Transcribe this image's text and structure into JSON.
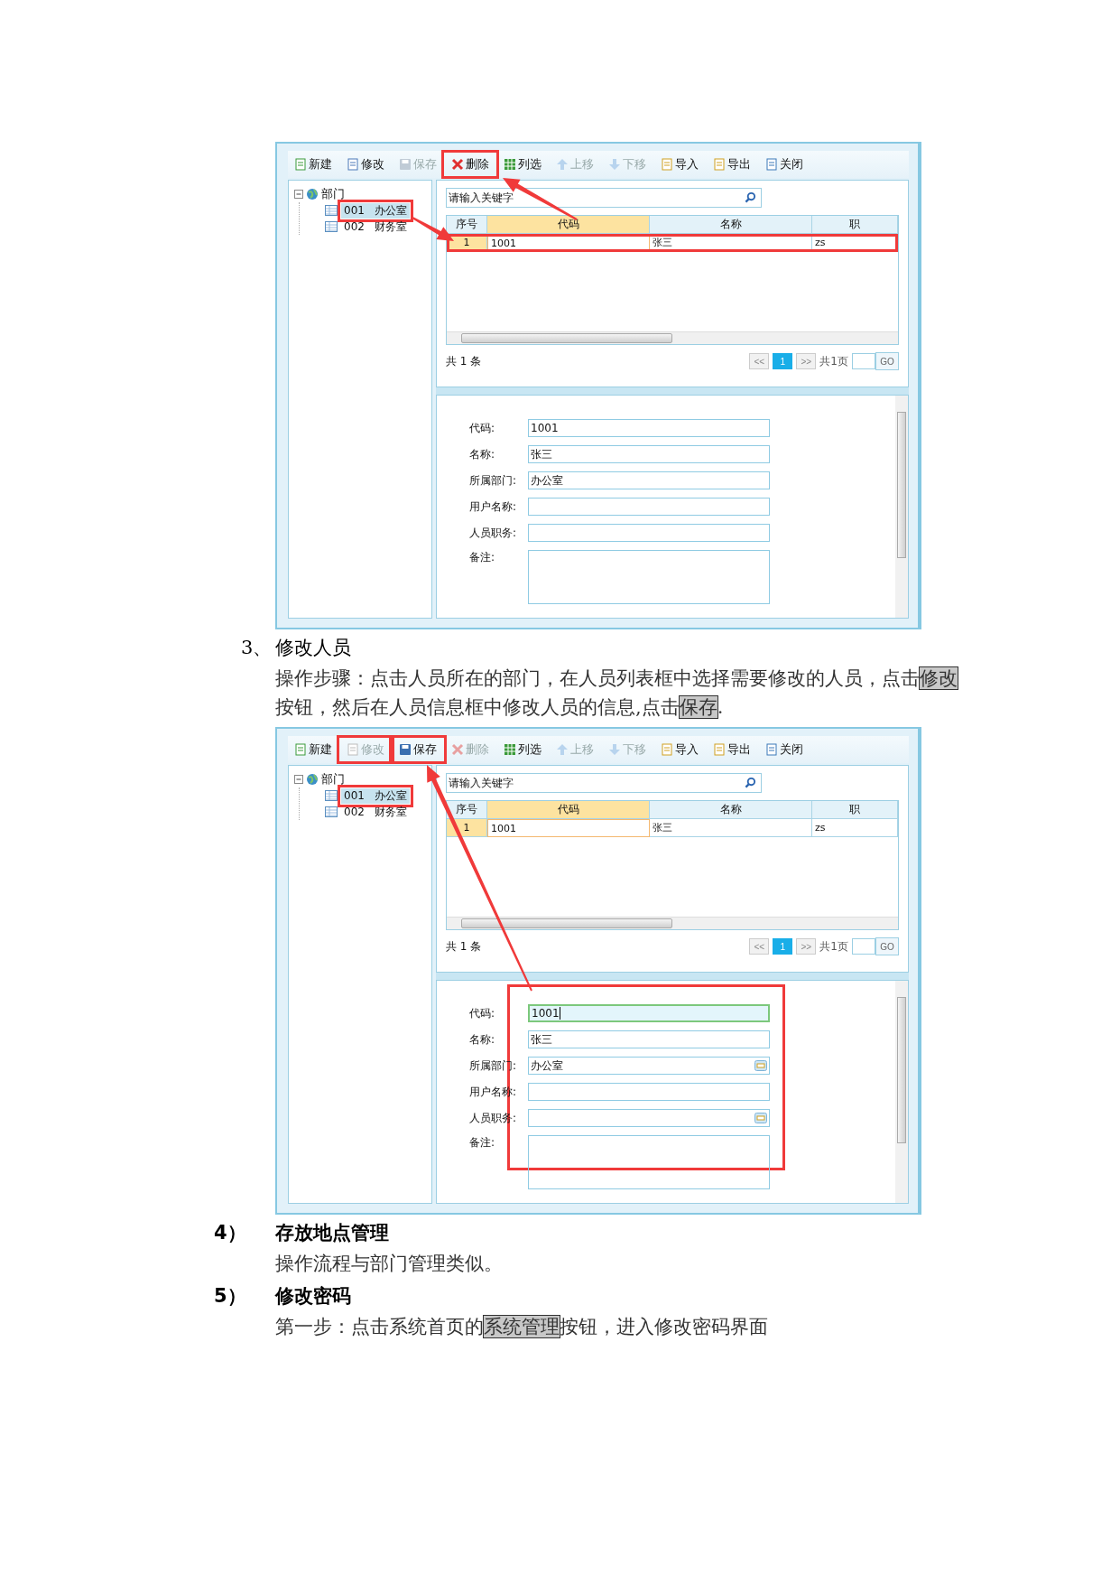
{
  "screenshots": [
    {
      "toolbar": [
        {
          "kind": "new",
          "label": "新建",
          "disabled": false,
          "highlighted": false
        },
        {
          "kind": "edit",
          "label": "修改",
          "disabled": false,
          "highlighted": false
        },
        {
          "kind": "save",
          "label": "保存",
          "disabled": true,
          "highlighted": false
        },
        {
          "kind": "delete",
          "label": "删除",
          "disabled": false,
          "highlighted": true
        },
        {
          "kind": "columns",
          "label": "列选",
          "disabled": false,
          "highlighted": false
        },
        {
          "kind": "up",
          "label": "上移",
          "disabled": true,
          "highlighted": false
        },
        {
          "kind": "down",
          "label": "下移",
          "disabled": true,
          "highlighted": false
        },
        {
          "kind": "import",
          "label": "导入",
          "disabled": false,
          "highlighted": false
        },
        {
          "kind": "export",
          "label": "导出",
          "disabled": false,
          "highlighted": false
        },
        {
          "kind": "close",
          "label": "关闭",
          "disabled": false,
          "highlighted": false
        }
      ],
      "tree": {
        "label": "部门",
        "expanded": true,
        "children": [
          {
            "code": "001",
            "name": "办公室",
            "selected": true,
            "highlighted": true
          },
          {
            "code": "002",
            "name": "财务室",
            "selected": false,
            "highlighted": false
          }
        ]
      },
      "search": {
        "placeholder": "请输入关键字"
      },
      "columns": [
        {
          "label": "序号",
          "sorted": false
        },
        {
          "label": "代码",
          "sorted": true
        },
        {
          "label": "名称",
          "sorted": false
        },
        {
          "label": "职",
          "sorted": false
        }
      ],
      "rows": [
        {
          "cells": [
            "1",
            "1001",
            "张三",
            "zs"
          ],
          "highlighted": true
        }
      ],
      "total": "共 1 条",
      "pager": {
        "prev": "<<",
        "page": "1",
        "next": ">>",
        "pages": "共1页",
        "go": "GO"
      },
      "form": {
        "highlighted": false,
        "fields": [
          {
            "kind": "text",
            "label": "代码:",
            "value": "1001",
            "focused": false
          },
          {
            "kind": "text",
            "label": "名称:",
            "value": "张三",
            "focused": false
          },
          {
            "kind": "text",
            "label": "所属部门:",
            "value": "办公室",
            "focused": false
          },
          {
            "kind": "text",
            "label": "用户名称:",
            "focused": false
          },
          {
            "kind": "text",
            "label": "人员职务:",
            "focused": false
          },
          {
            "kind": "textarea",
            "label": "备注:",
            "focused": false
          }
        ]
      },
      "arrows": [
        {
          "kind": "tree-to-grid"
        },
        {
          "kind": "grid-to-toolbar"
        }
      ]
    },
    {
      "toolbar": [
        {
          "kind": "new",
          "label": "新建",
          "disabled": false,
          "highlighted": false
        },
        {
          "kind": "edit",
          "label": "修改",
          "disabled": true,
          "highlighted": true
        },
        {
          "kind": "save",
          "label": "保存",
          "disabled": false,
          "highlighted": true
        },
        {
          "kind": "delete",
          "label": "删除",
          "disabled": true,
          "highlighted": false
        },
        {
          "kind": "columns",
          "label": "列选",
          "disabled": false,
          "highlighted": false
        },
        {
          "kind": "up",
          "label": "上移",
          "disabled": true,
          "highlighted": false
        },
        {
          "kind": "down",
          "label": "下移",
          "disabled": true,
          "highlighted": false
        },
        {
          "kind": "import",
          "label": "导入",
          "disabled": false,
          "highlighted": false
        },
        {
          "kind": "export",
          "label": "导出",
          "disabled": false,
          "highlighted": false
        },
        {
          "kind": "close",
          "label": "关闭",
          "disabled": false,
          "highlighted": false
        }
      ],
      "tree": {
        "label": "部门",
        "expanded": true,
        "children": [
          {
            "code": "001",
            "name": "办公室",
            "selected": true,
            "highlighted": true
          },
          {
            "code": "002",
            "name": "财务室",
            "selected": false,
            "highlighted": false
          }
        ]
      },
      "search": {
        "placeholder": "请输入关键字"
      },
      "columns": [
        {
          "label": "序号",
          "sorted": false
        },
        {
          "label": "代码",
          "sorted": true
        },
        {
          "label": "名称",
          "sorted": false
        },
        {
          "label": "职",
          "sorted": false
        }
      ],
      "rows": [
        {
          "cells": [
            "1",
            "1001",
            "张三",
            "zs"
          ],
          "highlighted": false
        }
      ],
      "total": "共 1 条",
      "pager": {
        "prev": "<<",
        "page": "1",
        "next": ">>",
        "pages": "共1页",
        "go": "GO"
      },
      "form": {
        "highlighted": true,
        "fields": [
          {
            "kind": "text",
            "label": "代码:",
            "value": "1001",
            "focused": true
          },
          {
            "kind": "text",
            "label": "名称:",
            "value": "张三",
            "focused": false
          },
          {
            "kind": "picker",
            "label": "所属部门:",
            "value": "办公室",
            "focused": false
          },
          {
            "kind": "text",
            "label": "用户名称:",
            "focused": false
          },
          {
            "kind": "picker",
            "label": "人员职务:",
            "focused": false
          },
          {
            "kind": "textarea",
            "label": "备注:",
            "focused": false
          }
        ]
      },
      "arrows": [
        {
          "kind": "form-to-toolbar"
        }
      ]
    }
  ],
  "blocks": [
    {
      "kind": "step",
      "number": "3、",
      "title": "修改人员",
      "paragraph": [
        {
          "text": "操作步骤：点击人员所在的部门，在人员列表框中选择需要修改的人员，点击",
          "highlighted": false
        },
        {
          "text": "修改",
          "highlighted": true
        },
        {
          "text": "按钮，然后在人员信息框中修改人员的信息,点击",
          "highlighted": false
        },
        {
          "text": "保存",
          "highlighted": true
        },
        {
          "text": ".",
          "highlighted": false
        }
      ]
    },
    {
      "kind": "heading",
      "number": "4）",
      "title": "存放地点管理",
      "paragraph": [
        {
          "text": "操作流程与部门管理类似。",
          "highlighted": false
        }
      ]
    },
    {
      "kind": "heading",
      "number": "5）",
      "title": "修改密码",
      "paragraph": [
        {
          "text": "第一步：点击系统首页的",
          "highlighted": false
        },
        {
          "text": "系统管理",
          "highlighted": true
        },
        {
          "text": "按钮，进入修改密码界面",
          "highlighted": false
        }
      ]
    }
  ]
}
